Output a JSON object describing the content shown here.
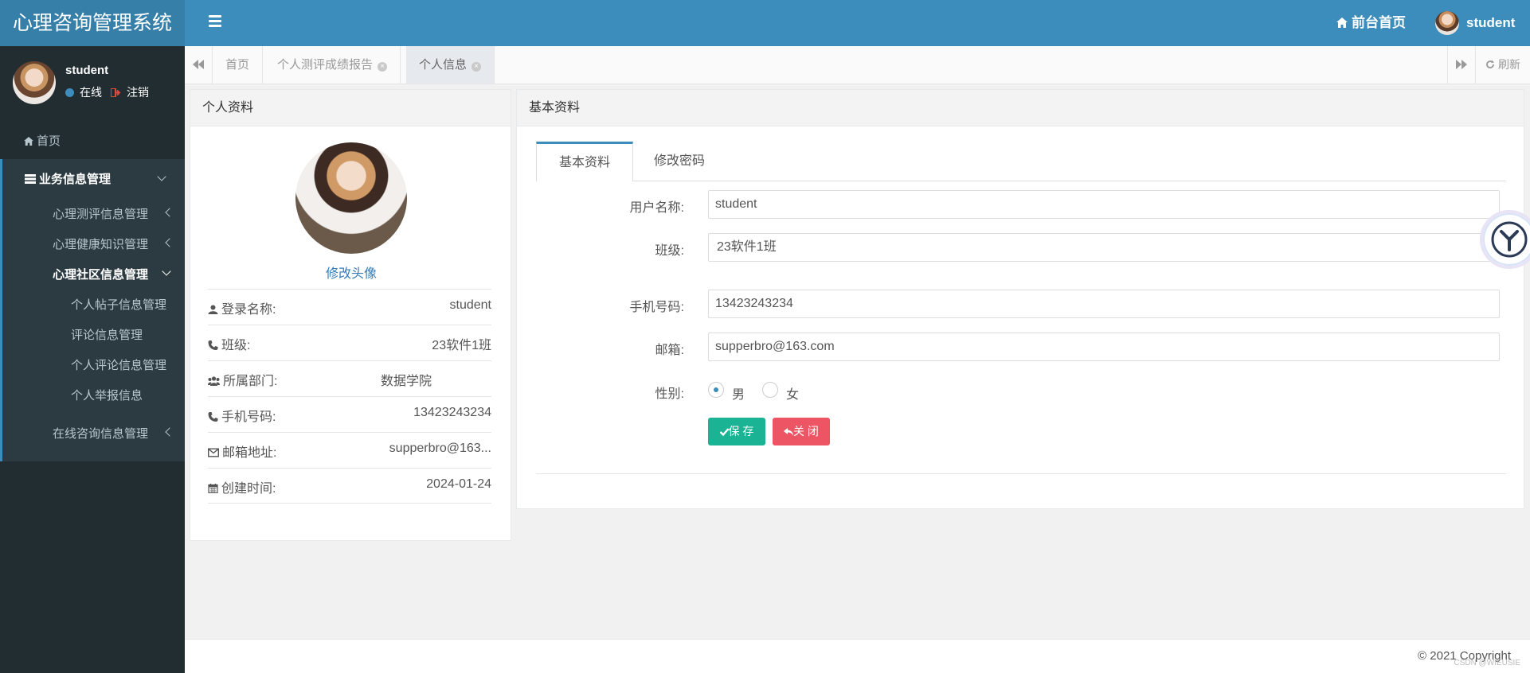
{
  "header": {
    "brand": "心理咨询管理系统",
    "front_link": "前台首页",
    "user": "student"
  },
  "sidebar": {
    "user_name": "student",
    "status": "在线",
    "logout": "注销",
    "home": "首页",
    "group_title": "业务信息管理",
    "items": [
      {
        "label": "心理测评信息管理"
      },
      {
        "label": "心理健康知识管理"
      },
      {
        "label": "心理社区信息管理"
      },
      {
        "label": "在线咨询信息管理"
      }
    ],
    "sub_items": [
      {
        "label": "个人帖子信息管理"
      },
      {
        "label": "评论信息管理"
      },
      {
        "label": "个人评论信息管理"
      },
      {
        "label": "个人举报信息"
      }
    ]
  },
  "tabs": {
    "items": [
      {
        "label": "首页"
      },
      {
        "label": "个人测评成绩报告"
      },
      {
        "label": "个人信息"
      }
    ],
    "refresh": "刷新"
  },
  "profile": {
    "title": "个人资料",
    "change_avatar": "修改头像",
    "rows": [
      {
        "label": "登录名称:",
        "value": "student"
      },
      {
        "label": "班级:",
        "value": "23软件1班"
      },
      {
        "label": "所属部门:",
        "value": "数据学院"
      },
      {
        "label": "手机号码:",
        "value": "13423243234"
      },
      {
        "label": "邮箱地址:",
        "value": "supperbro@163..."
      },
      {
        "label": "创建时间:",
        "value": "2024-01-24"
      }
    ]
  },
  "form": {
    "title": "基本资料",
    "tabs": [
      {
        "label": "基本资料"
      },
      {
        "label": "修改密码"
      }
    ],
    "username_label": "用户名称:",
    "username_value": "student",
    "class_label": "班级:",
    "class_value": "23软件1班",
    "phone_label": "手机号码:",
    "phone_value": "13423243234",
    "email_label": "邮箱:",
    "email_value": "supperbro@163.com",
    "gender_label": "性别:",
    "gender_male": "男",
    "gender_female": "女",
    "save": "保 存",
    "close": "关 闭"
  },
  "footer": {
    "copyright": "© 2021 Copyright",
    "watermark": "CSDN @WIEUSIE"
  },
  "colors": {
    "header": "#3c8dbc",
    "brand": "#367fa9",
    "sidebar": "#222d32",
    "save": "#1ab394",
    "close": "#ed5565"
  }
}
